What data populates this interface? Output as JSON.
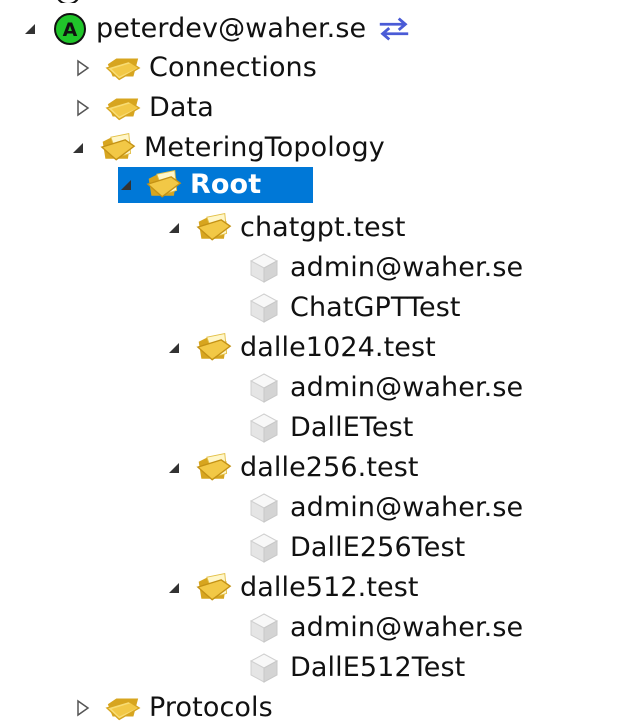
{
  "colors": {
    "background": "#ffffff",
    "selection": "#0078d7",
    "folder": "#f2c846",
    "folder_dark": "#d7a51f",
    "account_green": "#20c52a",
    "exchange_blue": "#4a5bd6",
    "node_cube": "#d9d9d9"
  },
  "tree": {
    "root_account": {
      "label": "peterdev@waher.se",
      "icon": "green-account-icon",
      "exchange_icon": "exchange-arrows-icon"
    },
    "connections": {
      "label": "Connections",
      "icon": "folder-icon"
    },
    "data": {
      "label": "Data",
      "icon": "folder-icon"
    },
    "metering_topology": {
      "label": "MeteringTopology",
      "icon": "open-folder-icon"
    },
    "root": {
      "label": "Root",
      "icon": "open-folder-icon"
    },
    "groups": [
      {
        "label": "chatgpt.test",
        "children": [
          {
            "label": "admin@waher.se"
          },
          {
            "label": "ChatGPTTest"
          }
        ]
      },
      {
        "label": "dalle1024.test",
        "children": [
          {
            "label": "admin@waher.se"
          },
          {
            "label": "DallETest"
          }
        ]
      },
      {
        "label": "dalle256.test",
        "children": [
          {
            "label": "admin@waher.se"
          },
          {
            "label": "DallE256Test"
          }
        ]
      },
      {
        "label": "dalle512.test",
        "children": [
          {
            "label": "admin@waher.se"
          },
          {
            "label": "DallE512Test"
          }
        ]
      }
    ],
    "protocols": {
      "label": "Protocols",
      "icon": "folder-icon"
    }
  }
}
